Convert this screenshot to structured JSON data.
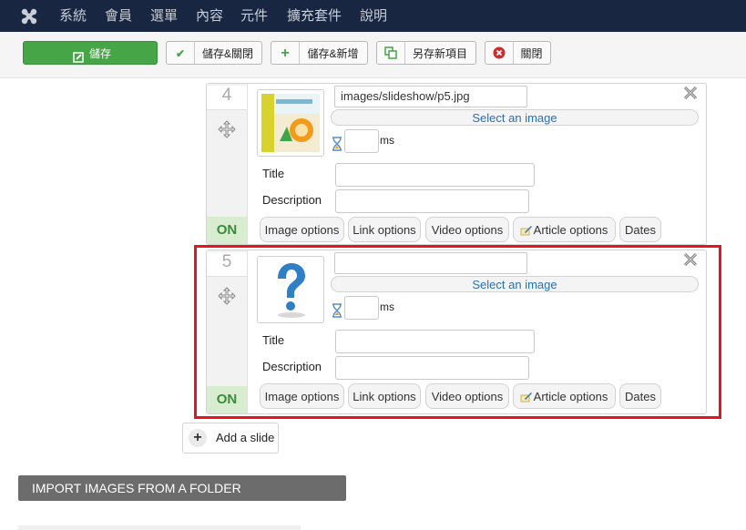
{
  "navbar": {
    "menu": [
      "系統",
      "會員",
      "選單",
      "內容",
      "元件",
      "擴充套件",
      "說明"
    ]
  },
  "toolbar": {
    "save": "儲存",
    "save_close": "儲存&關閉",
    "save_new": "儲存&新增",
    "save_copy": "另存新項目",
    "close": "關閉"
  },
  "slides": [
    {
      "number": "4",
      "image_path": "images/slideshow/p5.jpg",
      "select_label": "Select an image",
      "ms_label": "ms",
      "title_label": "Title",
      "description_label": "Description",
      "status": "ON",
      "option_buttons": [
        "Image options",
        "Link options",
        "Video options",
        "Article options",
        "Dates"
      ]
    },
    {
      "number": "5",
      "image_path": "",
      "select_label": "Select an image",
      "ms_label": "ms",
      "title_label": "Title",
      "description_label": "Description",
      "status": "ON",
      "option_buttons": [
        "Image options",
        "Link options",
        "Video options",
        "Article options",
        "Dates"
      ]
    }
  ],
  "add_slide": "Add a slide",
  "import_images": "IMPORT IMAGES FROM A FOLDER",
  "colors": {
    "navbar": "#182641",
    "save_button": "#46a546",
    "highlight": "#e8141c",
    "on_badge": "#d8eccf",
    "select_link": "#2a6fb6"
  },
  "icons": [
    "joomla-logo-icon",
    "edit-icon",
    "check-icon",
    "plus-icon",
    "copy-icon",
    "close-circle-icon",
    "move-icon",
    "hourglass-icon",
    "article-pencil-icon",
    "remove-x-icon",
    "question-mark-icon"
  ]
}
